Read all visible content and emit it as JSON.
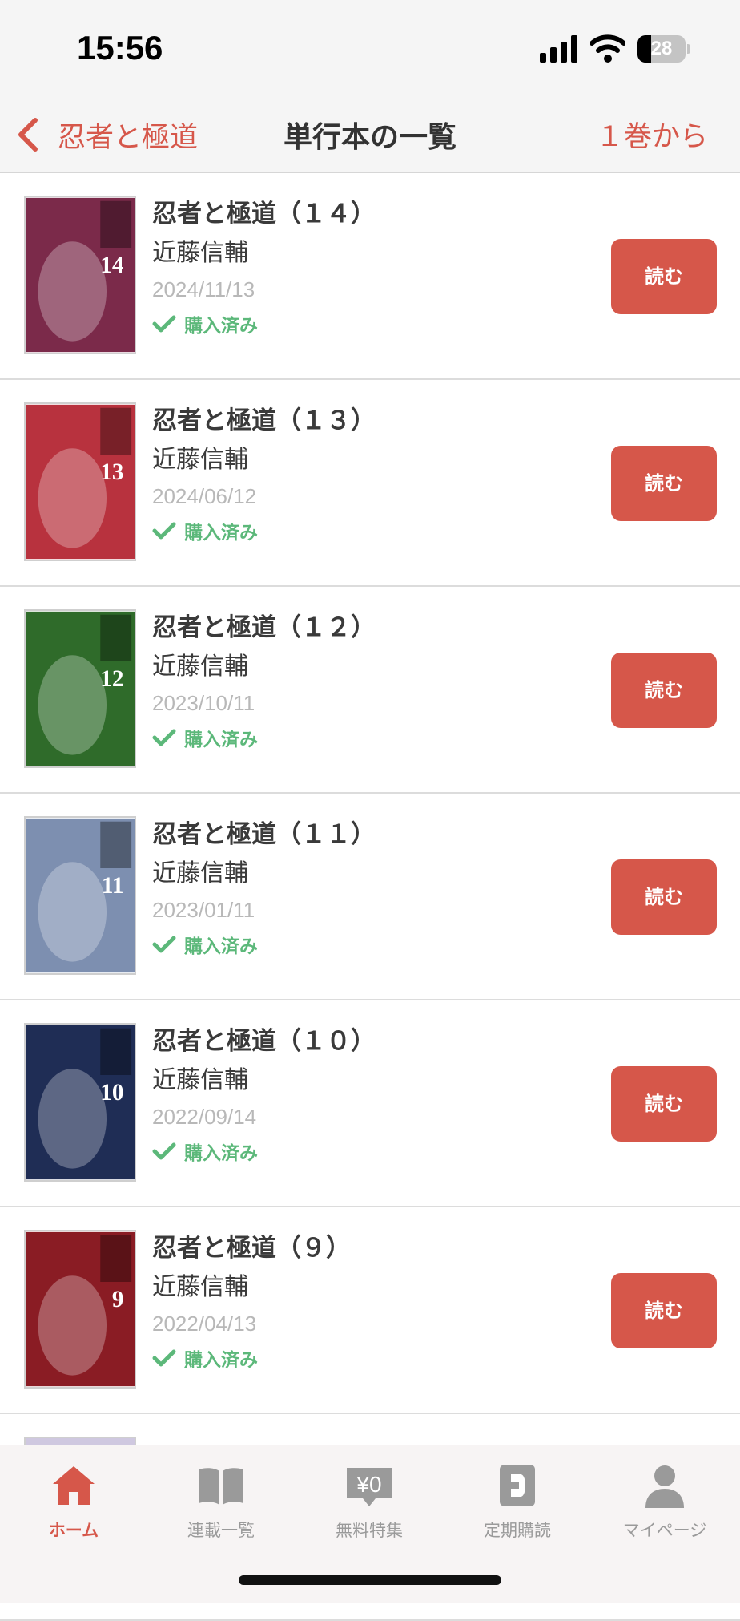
{
  "status_bar": {
    "time": "15:56",
    "battery": "28",
    "battery_level": 0.28,
    "icons": [
      "cellular-signal-icon",
      "wifi-icon",
      "battery-icon"
    ]
  },
  "nav": {
    "back_label": "忍者と極道",
    "title": "単行本の一覧",
    "sort_label": "１巻から"
  },
  "volumes": [
    {
      "title": "忍者と極道（１４）",
      "author": "近藤信輔",
      "date": "2024/11/13",
      "status": "購入済み",
      "read_label": "読む",
      "cover_number": "14",
      "cover_color": "#7b2a4a"
    },
    {
      "title": "忍者と極道（１３）",
      "author": "近藤信輔",
      "date": "2024/06/12",
      "status": "購入済み",
      "read_label": "読む",
      "cover_number": "13",
      "cover_color": "#b8323e"
    },
    {
      "title": "忍者と極道（１２）",
      "author": "近藤信輔",
      "date": "2023/10/11",
      "status": "購入済み",
      "read_label": "読む",
      "cover_number": "12",
      "cover_color": "#2f6b2a"
    },
    {
      "title": "忍者と極道（１１）",
      "author": "近藤信輔",
      "date": "2023/01/11",
      "status": "購入済み",
      "read_label": "読む",
      "cover_number": "11",
      "cover_color": "#7d8fb0"
    },
    {
      "title": "忍者と極道（１０）",
      "author": "近藤信輔",
      "date": "2022/09/14",
      "status": "購入済み",
      "read_label": "読む",
      "cover_number": "10",
      "cover_color": "#1f2d55"
    },
    {
      "title": "忍者と極道（９）",
      "author": "近藤信輔",
      "date": "2022/04/13",
      "status": "購入済み",
      "read_label": "読む",
      "cover_number": "9",
      "cover_color": "#8a1c24"
    }
  ],
  "tab_bar": {
    "tabs": [
      {
        "label": "ホーム",
        "icon": "home-icon",
        "active": true
      },
      {
        "label": "連載一覧",
        "icon": "open-book-icon",
        "active": false
      },
      {
        "label": "無料特集",
        "icon": "free-yen-tag-icon",
        "active": false
      },
      {
        "label": "定期購読",
        "icon": "subscription-icon",
        "active": false
      },
      {
        "label": "マイページ",
        "icon": "person-icon",
        "active": false
      }
    ]
  },
  "colors": {
    "accent": "#d6574a",
    "purchased": "#5cb87a",
    "date_text": "#b8b8b8",
    "bar_background": "#f5f5f5"
  }
}
